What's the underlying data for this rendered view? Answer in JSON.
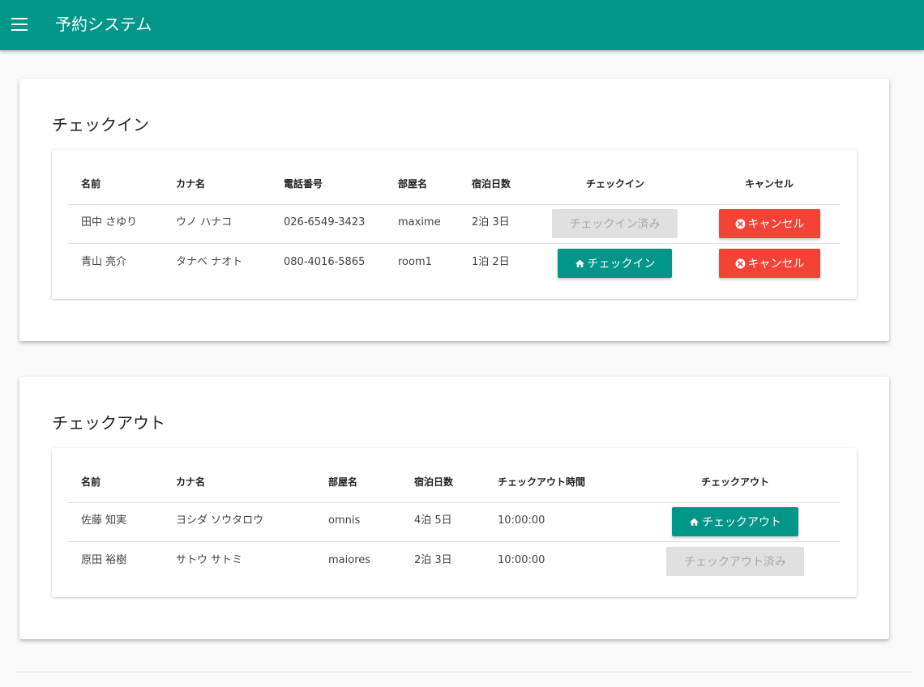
{
  "app": {
    "title": "予約システム",
    "menu_icon": "menu-icon"
  },
  "theme": {
    "primary": "#009688",
    "danger": "#f44336",
    "disabled": "#e0e0e0"
  },
  "checkin": {
    "title": "チェックイン",
    "headers": [
      "名前",
      "カナ名",
      "電話番号",
      "部屋名",
      "宿泊日数",
      "チェックイン",
      "キャンセル"
    ],
    "rows": [
      {
        "name": "田中 さゆり",
        "kana": "ウノ ハナコ",
        "phone": "026-6549-3423",
        "room": "maxime",
        "nights": "2泊 3日",
        "action": {
          "label": "チェックイン済み",
          "state": "disabled"
        },
        "cancel": {
          "label": "キャンセル",
          "icon": "cancel-circle-icon"
        }
      },
      {
        "name": "青山 亮介",
        "kana": "タナベ ナオト",
        "phone": "080-4016-5865",
        "room": "room1",
        "nights": "1泊 2日",
        "action": {
          "label": "チェックイン",
          "state": "enabled",
          "icon": "home-icon"
        },
        "cancel": {
          "label": "キャンセル",
          "icon": "cancel-circle-icon"
        }
      }
    ]
  },
  "checkout": {
    "title": "チェックアウト",
    "headers": [
      "名前",
      "カナ名",
      "部屋名",
      "宿泊日数",
      "チェックアウト時間",
      "チェックアウト"
    ],
    "rows": [
      {
        "name": "佐藤 知実",
        "kana": "ヨシダ ソウタロウ",
        "room": "omnis",
        "nights": "4泊 5日",
        "time": "10:00:00",
        "action": {
          "label": "チェックアウト",
          "state": "enabled",
          "icon": "home-icon"
        }
      },
      {
        "name": "原田 裕樹",
        "kana": "サトウ サトミ",
        "room": "maiores",
        "nights": "2泊 3日",
        "time": "10:00:00",
        "action": {
          "label": "チェックアウト済み",
          "state": "disabled"
        }
      }
    ]
  }
}
